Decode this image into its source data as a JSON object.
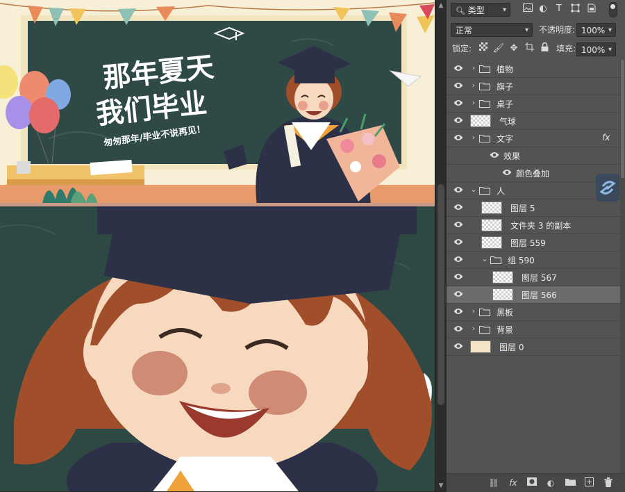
{
  "artwork": {
    "title_line1": "那年夏天",
    "title_line2": "我们毕业",
    "subtitle": "匆匆那年/毕业不说再见！"
  },
  "top_filters": {
    "kind_label": "类型"
  },
  "blend": {
    "mode": "正常",
    "opacity_label": "不透明度:",
    "opacity_value": "100%"
  },
  "lock_row": {
    "lock_label": "锁定:",
    "fill_label": "填充:",
    "fill_value": "100%"
  },
  "layers": [
    {
      "name": "植物",
      "type": "group",
      "indent": 0,
      "expanded": false,
      "selected": false
    },
    {
      "name": "旗子",
      "type": "group",
      "indent": 0,
      "expanded": false,
      "selected": false
    },
    {
      "name": "桌子",
      "type": "group",
      "indent": 0,
      "expanded": false,
      "selected": false
    },
    {
      "name": "气球",
      "type": "layer",
      "indent": 0,
      "selected": false
    },
    {
      "name": "文字",
      "type": "group",
      "indent": 0,
      "expanded": false,
      "selected": false,
      "fx": "fx"
    },
    {
      "name": "效果",
      "type": "effect-header",
      "indent": 1,
      "selected": false
    },
    {
      "name": "颜色叠加",
      "type": "effect",
      "indent": 2,
      "selected": false
    },
    {
      "name": "人",
      "type": "group",
      "indent": 0,
      "expanded": true,
      "selected": false
    },
    {
      "name": "图层 5",
      "type": "layer",
      "indent": 1,
      "selected": false
    },
    {
      "name": "文件夹 3 的副本",
      "type": "layer",
      "indent": 1,
      "selected": false
    },
    {
      "name": "图层 559",
      "type": "layer",
      "indent": 1,
      "selected": false
    },
    {
      "name": "组 590",
      "type": "group",
      "indent": 1,
      "expanded": true,
      "selected": false
    },
    {
      "name": "图层 567",
      "type": "layer",
      "indent": 2,
      "selected": false
    },
    {
      "name": "图层 566",
      "type": "layer",
      "indent": 2,
      "selected": true
    },
    {
      "name": "黑板",
      "type": "group",
      "indent": 0,
      "expanded": false,
      "selected": false
    },
    {
      "name": "背景",
      "type": "group",
      "indent": 0,
      "expanded": false,
      "selected": false
    },
    {
      "name": "图层 0",
      "type": "layer",
      "indent": 0,
      "selected": false,
      "swatch": "#f5e3c3"
    }
  ],
  "colors": {
    "chalkboard": "#2f4a46",
    "chalkboard_zoom": "#2e4844",
    "gown": "#2d3147",
    "hair": "#a14e2b",
    "skin": "#f6d9be",
    "cheek": "#cf8b74",
    "board_frame": "#f1e4bf",
    "wall": "#f4ecd0"
  }
}
